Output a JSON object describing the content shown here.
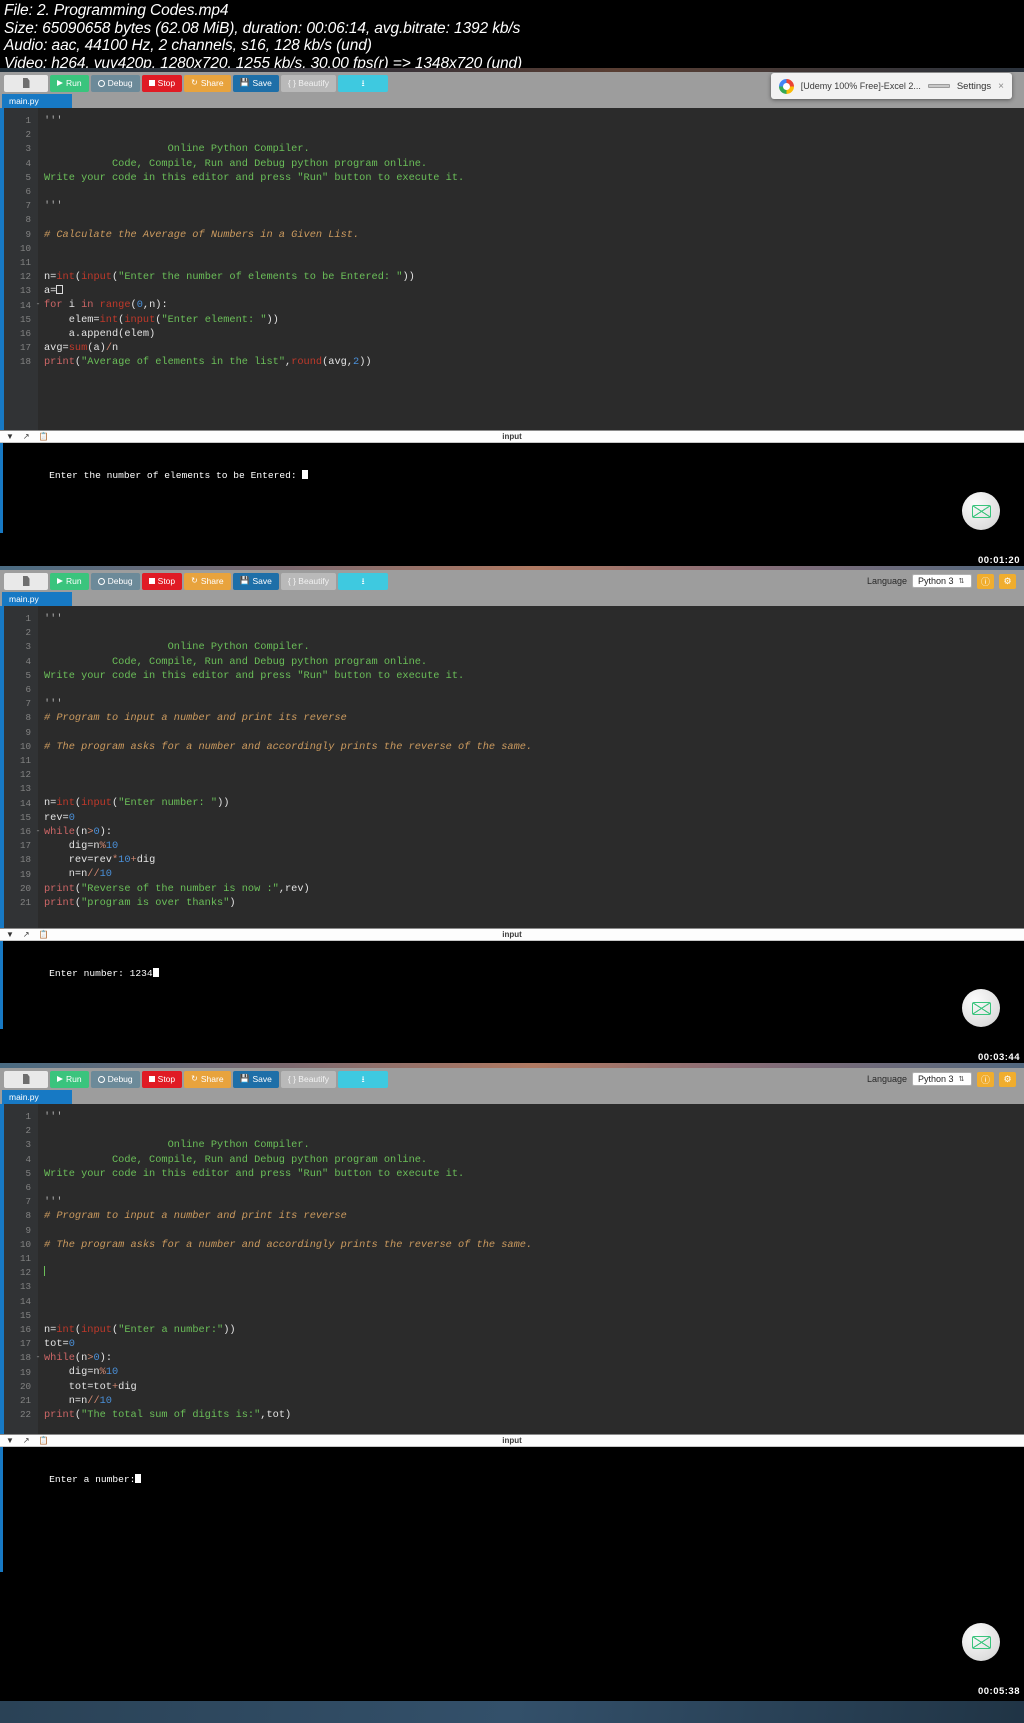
{
  "meta": {
    "line1": "File: 2. Programming Codes.mp4",
    "line2": "Size: 65090658 bytes (62.08 MiB), duration: 00:06:14, avg.bitrate: 1392 kb/s",
    "line3": "Audio: aac, 44100 Hz, 2 channels, s16, 128 kb/s (und)",
    "line4": "Video: h264, yuv420p, 1280x720, 1255 kb/s, 30.00 fps(r) => 1348x720 (und)"
  },
  "toolbar": {
    "file_icon": "document-icon",
    "run": "Run",
    "debug": "Debug",
    "stop": "Stop",
    "share": "Share",
    "save": "Save",
    "beautify": "{ } Beautify",
    "download_icon": "download-icon",
    "language_label": "Language",
    "language_value": "Python 3",
    "settings_icon": "info-icon",
    "theme_icon": "gear-icon"
  },
  "tab": {
    "name": "main.py"
  },
  "inputbar": {
    "chevron": "chevron-down-icon",
    "expand": "expand-icon",
    "clipboard": "clipboard-icon",
    "label": "input"
  },
  "toast": {
    "title": "[Udemy 100% Free]-Excel 2...",
    "settings": "Settings",
    "close": "×"
  },
  "shots": [
    {
      "id": "shot-1",
      "timestamp": "00:01:20",
      "has_language": false,
      "has_toast": true,
      "lines": [
        {
          "n": 1,
          "html": "<span class='k-tri'>'''</span>"
        },
        {
          "n": 2,
          "html": ""
        },
        {
          "n": 3,
          "html": "<span class='k-str'>                    Online Python Compiler.</span>"
        },
        {
          "n": 4,
          "html": "<span class='k-str'>           Code, Compile, Run and Debug python program online.</span>"
        },
        {
          "n": 5,
          "html": "<span class='k-str'>Write your code in this editor and press \"Run\" button to execute it.</span>"
        },
        {
          "n": 6,
          "html": ""
        },
        {
          "n": 7,
          "html": "<span class='k-tri'>'''</span>"
        },
        {
          "n": 8,
          "html": ""
        },
        {
          "n": 9,
          "html": "<span class='k-com'># Calculate the Average of Numbers in a Given List.</span>"
        },
        {
          "n": 10,
          "html": ""
        },
        {
          "n": 11,
          "html": ""
        },
        {
          "n": 12,
          "html": "<span class='k-pln'>n=</span><span class='k-fn'>int</span><span class='k-pln'>(</span><span class='k-fn'>input</span><span class='k-pln'>(</span><span class='k-str'>\"Enter the number of elements to be Entered: \"</span><span class='k-pln'>))</span>"
        },
        {
          "n": 13,
          "html": "<span class='k-pln'>a=</span><span class='cursor-box'></span>"
        },
        {
          "n": 14,
          "html": "<span class='k-kw'>for</span><span class='k-pln'> i </span><span class='k-kw'>in</span><span class='k-pln'> </span><span class='k-fn'>range</span><span class='k-pln'>(</span><span class='k-num'>0</span><span class='k-pln'>,n):</span>",
          "fold": true
        },
        {
          "n": 15,
          "html": "<span class='k-pln'>    elem=</span><span class='k-fn'>int</span><span class='k-pln'>(</span><span class='k-fn'>input</span><span class='k-pln'>(</span><span class='k-str'>\"Enter element: \"</span><span class='k-pln'>))</span>"
        },
        {
          "n": 16,
          "html": "<span class='k-pln'>    a.append(elem)</span>"
        },
        {
          "n": 17,
          "html": "<span class='k-pln'>avg=</span><span class='k-fn'>sum</span><span class='k-pln'>(a)</span><span class='k-op'>/</span><span class='k-pln'>n</span>"
        },
        {
          "n": 18,
          "html": "<span class='k-kw'>print</span><span class='k-pln'>(</span><span class='k-str'>\"Average of elements in the list\"</span><span class='k-pln'>,</span><span class='k-fn'>round</span><span class='k-pln'>(avg,</span><span class='k-num'>2</span><span class='k-pln'>))</span>"
        }
      ],
      "console": "Enter the number of elements to be Entered: ",
      "console_caret": true
    },
    {
      "id": "shot-2",
      "timestamp": "00:03:44",
      "has_language": true,
      "has_toast": false,
      "lines": [
        {
          "n": 1,
          "html": "<span class='k-tri'>'''</span>"
        },
        {
          "n": 2,
          "html": ""
        },
        {
          "n": 3,
          "html": "<span class='k-str'>                    Online Python Compiler.</span>"
        },
        {
          "n": 4,
          "html": "<span class='k-str'>           Code, Compile, Run and Debug python program online.</span>"
        },
        {
          "n": 5,
          "html": "<span class='k-str'>Write your code in this editor and press \"Run\" button to execute it.</span>"
        },
        {
          "n": 6,
          "html": ""
        },
        {
          "n": 7,
          "html": "<span class='k-tri'>'''</span>"
        },
        {
          "n": 8,
          "html": "<span class='k-com'># Program to input a number and print its reverse</span>"
        },
        {
          "n": 9,
          "html": ""
        },
        {
          "n": 10,
          "html": "<span class='k-com'># The program asks for a number and accordingly prints the reverse of the same.</span>"
        },
        {
          "n": 11,
          "html": ""
        },
        {
          "n": 12,
          "html": ""
        },
        {
          "n": 13,
          "html": ""
        },
        {
          "n": 14,
          "html": "<span class='k-pln'>n=</span><span class='k-fn'>int</span><span class='k-pln'>(</span><span class='k-fn'>input</span><span class='k-pln'>(</span><span class='k-str'>\"Enter number: \"</span><span class='k-pln'>))</span>"
        },
        {
          "n": 15,
          "html": "<span class='k-pln'>rev=</span><span class='k-num'>0</span>"
        },
        {
          "n": 16,
          "html": "<span class='k-kw'>while</span><span class='k-pln'>(n</span><span class='k-op'>&gt;</span><span class='k-num'>0</span><span class='k-pln'>):</span>",
          "fold": true
        },
        {
          "n": 17,
          "html": "<span class='k-pln'>    dig=n</span><span class='k-op'>%</span><span class='k-num'>10</span>"
        },
        {
          "n": 18,
          "html": "<span class='k-pln'>    rev=rev</span><span class='k-op'>*</span><span class='k-num'>10</span><span class='k-op'>+</span><span class='k-pln'>dig</span>"
        },
        {
          "n": 19,
          "html": "<span class='k-pln'>    n=n</span><span class='k-op'>//</span><span class='k-num'>10</span>"
        },
        {
          "n": 20,
          "html": "<span class='k-kw'>print</span><span class='k-pln'>(</span><span class='k-str'>\"Reverse of the number is now :\"</span><span class='k-pln'>,rev)</span>"
        },
        {
          "n": 21,
          "html": "<span class='k-kw'>print</span><span class='k-pln'>(</span><span class='k-str'>\"program is over thanks\"</span><span class='k-pln'>)</span>"
        }
      ],
      "console": "Enter number: 1234",
      "console_caret": true
    },
    {
      "id": "shot-3",
      "timestamp": "00:05:38",
      "has_language": true,
      "has_toast": false,
      "lines": [
        {
          "n": 1,
          "html": "<span class='k-tri'>'''</span>"
        },
        {
          "n": 2,
          "html": ""
        },
        {
          "n": 3,
          "html": "<span class='k-str'>                    Online Python Compiler.</span>"
        },
        {
          "n": 4,
          "html": "<span class='k-str'>           Code, Compile, Run and Debug python program online.</span>"
        },
        {
          "n": 5,
          "html": "<span class='k-str'>Write your code in this editor and press \"Run\" button to execute it.</span>"
        },
        {
          "n": 6,
          "html": ""
        },
        {
          "n": 7,
          "html": "<span class='k-tri'>'''</span>"
        },
        {
          "n": 8,
          "html": "<span class='k-com'># Program to input a number and print its reverse</span>"
        },
        {
          "n": 9,
          "html": ""
        },
        {
          "n": 10,
          "html": "<span class='k-com'># The program asks for a number and accordingly prints the reverse of the same.</span>"
        },
        {
          "n": 11,
          "html": ""
        },
        {
          "n": 12,
          "html": "",
          "caret": true
        },
        {
          "n": 13,
          "html": ""
        },
        {
          "n": 14,
          "html": ""
        },
        {
          "n": 15,
          "html": ""
        },
        {
          "n": 16,
          "html": "<span class='k-pln'>n=</span><span class='k-fn'>int</span><span class='k-pln'>(</span><span class='k-fn'>input</span><span class='k-pln'>(</span><span class='k-str'>\"Enter a number:\"</span><span class='k-pln'>))</span>"
        },
        {
          "n": 17,
          "html": "<span class='k-pln'>tot=</span><span class='k-num'>0</span>"
        },
        {
          "n": 18,
          "html": "<span class='k-kw'>while</span><span class='k-pln'>(n</span><span class='k-op'>&gt;</span><span class='k-num'>0</span><span class='k-pln'>):</span>",
          "fold": true
        },
        {
          "n": 19,
          "html": "<span class='k-pln'>    dig=n</span><span class='k-op'>%</span><span class='k-num'>10</span>"
        },
        {
          "n": 20,
          "html": "<span class='k-pln'>    tot=tot</span><span class='k-op'>+</span><span class='k-pln'>dig</span>"
        },
        {
          "n": 21,
          "html": "<span class='k-pln'>    n=n</span><span class='k-op'>//</span><span class='k-num'>10</span>"
        },
        {
          "n": 22,
          "html": "<span class='k-kw'>print</span><span class='k-pln'>(</span><span class='k-str'>\"The total sum of digits is:\"</span><span class='k-pln'>,tot)</span>"
        }
      ],
      "console": "Enter a number:",
      "console_caret": true
    }
  ]
}
